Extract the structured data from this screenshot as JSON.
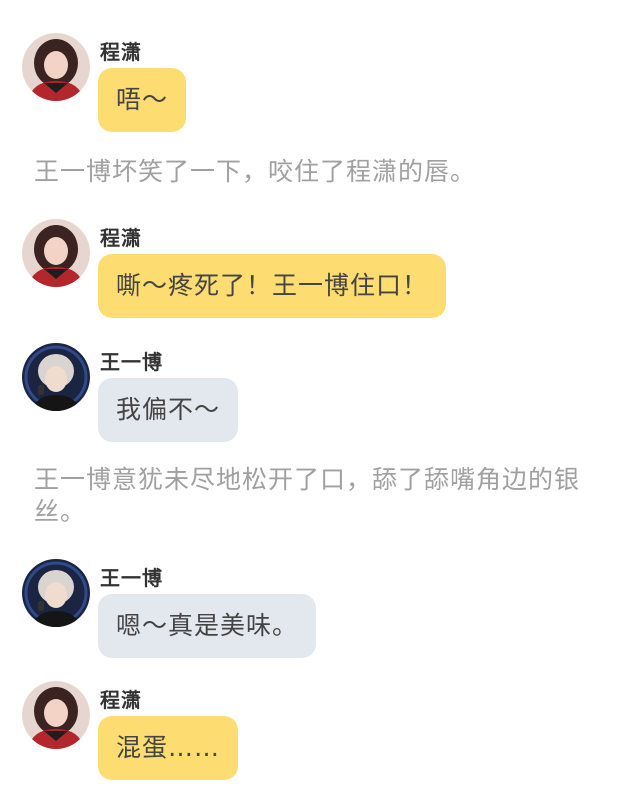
{
  "colors": {
    "self_bubble": "#fddc72",
    "other_bubble": "#e3e8ef",
    "narration_text": "#a0a0a0"
  },
  "messages": [
    {
      "sender": "程潇",
      "text": "唔～",
      "bubble": "yellow",
      "avatar_icon": "cheng-xiao-avatar"
    },
    {
      "narration": "王一博坏笑了一下，咬住了程潇的唇。"
    },
    {
      "sender": "程潇",
      "text": "嘶～疼死了！王一博住口！",
      "bubble": "yellow",
      "avatar_icon": "cheng-xiao-avatar"
    },
    {
      "sender": "王一博",
      "text": "我偏不～",
      "bubble": "grey",
      "avatar_icon": "wang-yibo-avatar"
    },
    {
      "narration": "王一博意犹未尽地松开了口，舔了舔嘴角边的银丝。"
    },
    {
      "sender": "王一博",
      "text": "嗯～真是美味。",
      "bubble": "grey",
      "avatar_icon": "wang-yibo-avatar"
    },
    {
      "sender": "程潇",
      "text": "混蛋……",
      "bubble": "yellow",
      "avatar_icon": "cheng-xiao-avatar"
    }
  ]
}
